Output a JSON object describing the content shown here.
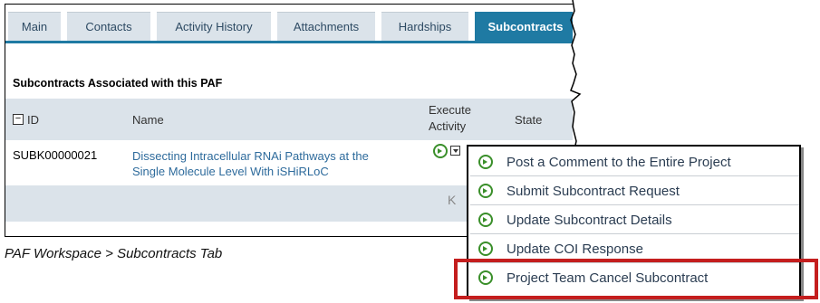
{
  "tabs": [
    {
      "label": "Main"
    },
    {
      "label": "Contacts"
    },
    {
      "label": "Activity History"
    },
    {
      "label": "Attachments"
    },
    {
      "label": "Hardships"
    },
    {
      "label": "Subcontracts",
      "active": true
    }
  ],
  "section": {
    "title": "Subcontracts Associated with this PAF"
  },
  "table": {
    "columns": {
      "id": "ID",
      "name": "Name",
      "execute_line1": "Execute",
      "execute_line2": "Activity",
      "state": "State"
    },
    "rows": [
      {
        "id": "SUBK00000021",
        "name_line1": "Dissecting Intracellular RNAi Pathways at the",
        "name_line2": "Single Molecule Level With iSHiRLoC"
      }
    ],
    "pager_first_glyph": "K"
  },
  "menu": {
    "items": [
      {
        "label": "Post a Comment to the Entire Project",
        "icon": "green-arrow-icon"
      },
      {
        "label": "Submit Subcontract Request",
        "icon": "green-arrow-icon"
      },
      {
        "label": "Update Subcontract Details",
        "icon": "green-arrow-icon"
      },
      {
        "label": "Update COI Response",
        "icon": "green-arrow-icon"
      },
      {
        "label": "Project Team Cancel Subcontract",
        "icon": "green-arrow-icon",
        "highlighted": true
      }
    ]
  },
  "caption": "PAF Workspace > Subcontracts Tab",
  "colors": {
    "active_tab": "#1f7aa3",
    "tab_bg": "#dbe3ea",
    "link": "#2e6b9c",
    "highlight_border": "#c41e1e",
    "icon_green": "#3a8f2a"
  }
}
